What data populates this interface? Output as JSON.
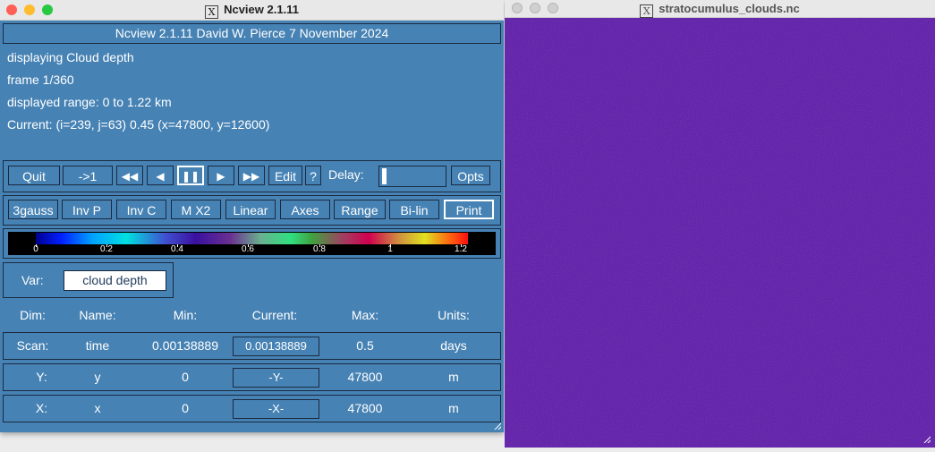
{
  "ncview_window": {
    "title": "Ncview 2.1.11",
    "banner": "Ncview 2.1.11 David W. Pierce 7 November 2024",
    "displaying": "displaying Cloud depth",
    "frame": "frame 1/360",
    "range": "displayed range: 0 to 1.22 km",
    "current": "Current: (i=239, j=63) 0.45 (x=47800, y=12600)",
    "controls": {
      "quit": "Quit",
      "to_one": "->1",
      "rewind": "◀◀",
      "back": "◀",
      "pause": "❚❚",
      "forward": "▶",
      "ffwd": "▶▶",
      "edit": "Edit",
      "help": "?",
      "delay_label": "Delay:",
      "opts": "Opts"
    },
    "options": [
      {
        "label": "3gauss"
      },
      {
        "label": "Inv P"
      },
      {
        "label": "Inv C"
      },
      {
        "label": "M X2"
      },
      {
        "label": "Linear"
      },
      {
        "label": "Axes"
      },
      {
        "label": "Range"
      },
      {
        "label": "Bi-lin"
      },
      {
        "label": "Print"
      }
    ],
    "colorbar": {
      "ticks": [
        "0",
        "0.2",
        "0.4",
        "0.6",
        "0.8",
        "1",
        "1.2"
      ]
    },
    "var_label": "Var:",
    "var_value": "cloud depth",
    "dim_headers": [
      "Dim:",
      "Name:",
      "Min:",
      "Current:",
      "Max:",
      "Units:"
    ],
    "dims": [
      {
        "dim": "Scan:",
        "name": "time",
        "min": "0.00138889",
        "current": "0.00138889",
        "max": "0.5",
        "units": "days"
      },
      {
        "dim": "Y:",
        "name": "y",
        "min": "0",
        "current": "-Y-",
        "max": "47800",
        "units": "m"
      },
      {
        "dim": "X:",
        "name": "x",
        "min": "0",
        "current": "-X-",
        "max": "47800",
        "units": "m"
      }
    ]
  },
  "image_window": {
    "title": "stratocumulus_clouds.nc"
  },
  "colors": {
    "panel_bg": "#4682b4",
    "image_fill": "#5e1aaa"
  }
}
